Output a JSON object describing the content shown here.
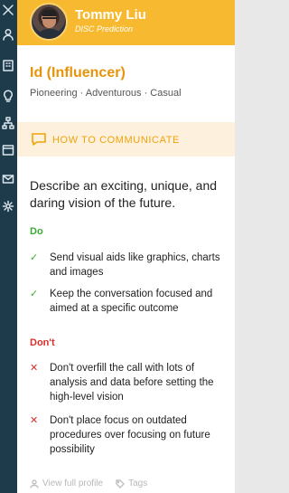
{
  "profile": {
    "name": "Tommy Liu",
    "subtitle": "DISC Prediction",
    "type": "Id (Influencer)",
    "traits": "Pioneering · Adventurous · Casual"
  },
  "communicate": {
    "label": "HOW TO COMMUNICATE",
    "summary": "Describe an exciting, unique, and daring vision of the future."
  },
  "do": {
    "heading": "Do",
    "items": [
      "Send visual aids like graphics, charts and images",
      "Keep the conversation focused and aimed at a specific outcome"
    ]
  },
  "dont": {
    "heading": "Don't",
    "items": [
      "Don't overfill the call with lots of analysis and data before setting the high-level vision",
      "Don't place focus on outdated procedures over focusing on future possibility"
    ]
  },
  "footer": {
    "profile_link": "View full profile",
    "tags_link": "Tags"
  },
  "rail_icons": [
    "close-icon",
    "person-icon",
    "building-icon",
    "lightbulb-icon",
    "org-chart-icon",
    "window-icon",
    "mail-icon",
    "settings-icon"
  ],
  "colors": {
    "header": "#f7b92f",
    "type_title": "#e8940a",
    "do": "#3aa935",
    "dont": "#d8312b",
    "rail": "#1d3b4b"
  }
}
